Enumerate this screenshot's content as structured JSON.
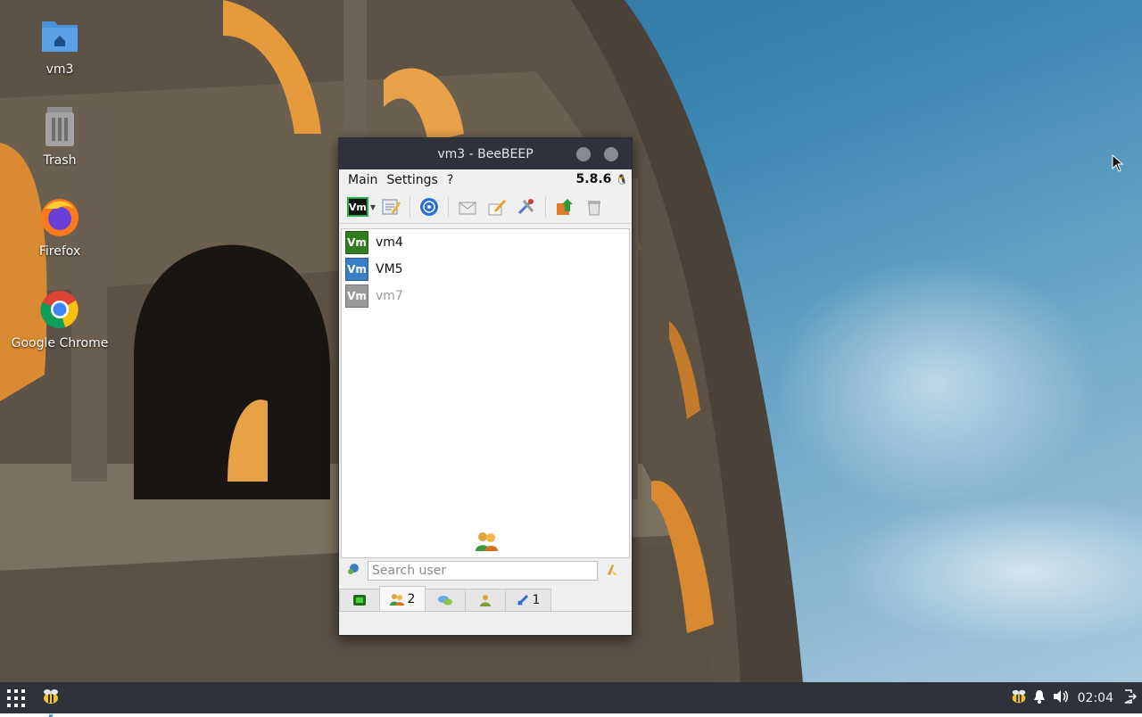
{
  "desktop": {
    "icons": [
      {
        "label": "vm3",
        "icon": "home-folder-icon"
      },
      {
        "label": "Trash",
        "icon": "trash-icon"
      },
      {
        "label": "Firefox",
        "icon": "firefox-icon"
      },
      {
        "label": "Google Chrome",
        "icon": "chrome-icon"
      }
    ]
  },
  "window": {
    "title": "vm3 - BeeBEEP",
    "menu": [
      "Main",
      "Settings",
      "?"
    ],
    "version": "5.8.6",
    "status_badge": "Vm",
    "users": [
      {
        "name": "vm4",
        "badge": "Vm",
        "color": "#2f7d1e",
        "online": true
      },
      {
        "name": "VM5",
        "badge": "Vm",
        "color": "#3a7fc4",
        "online": true
      },
      {
        "name": "vm7",
        "badge": "Vm",
        "color": "#9a9a9a",
        "online": false
      }
    ],
    "search": {
      "placeholder": "Search user",
      "value": ""
    },
    "tabs": [
      {
        "icon": "status-icon",
        "count": ""
      },
      {
        "icon": "users-icon",
        "count": "2"
      },
      {
        "icon": "chats-icon",
        "count": ""
      },
      {
        "icon": "groups-icon",
        "count": ""
      },
      {
        "icon": "files-icon",
        "count": "1"
      }
    ]
  },
  "taskbar": {
    "clock": "02:04"
  }
}
